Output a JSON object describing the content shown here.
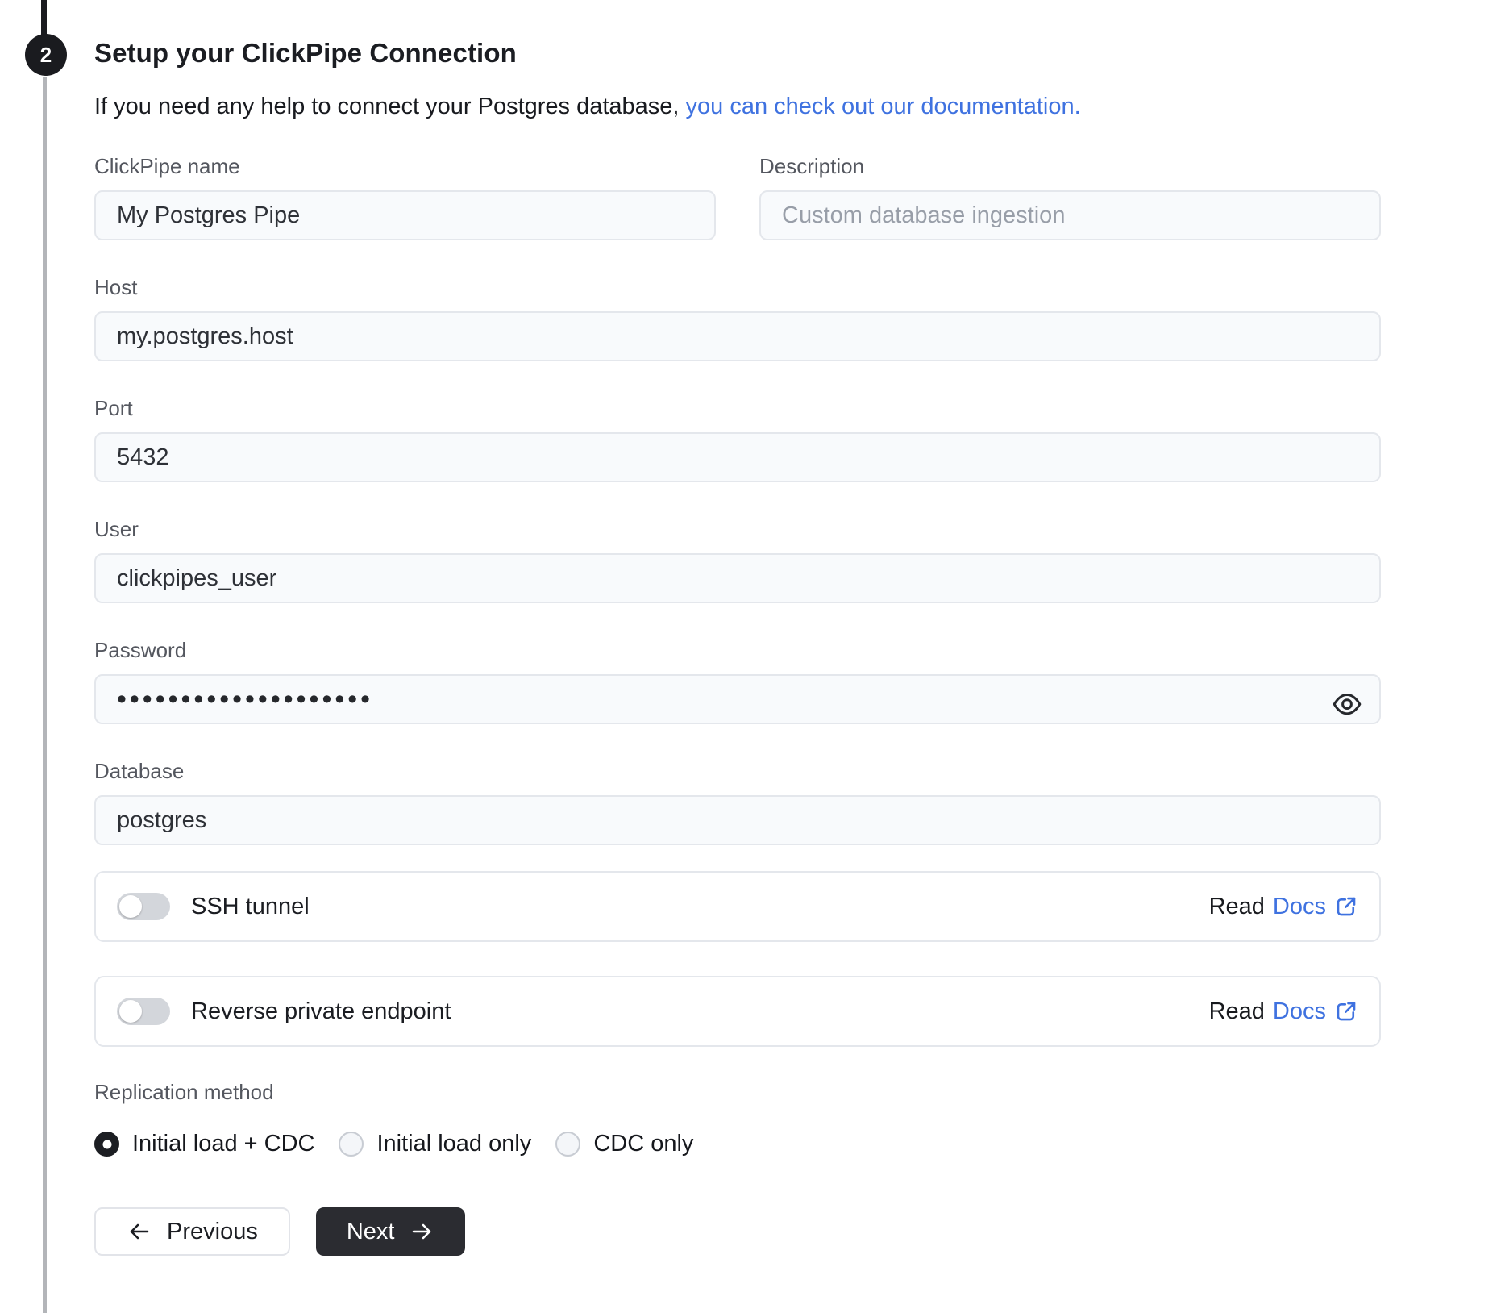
{
  "step": {
    "number": "2"
  },
  "header": {
    "title": "Setup your ClickPipe Connection",
    "subtitle_text": "If you need any help to connect your Postgres database,",
    "subtitle_link": "you can check out our documentation."
  },
  "form": {
    "clickpipe_name": {
      "label": "ClickPipe name",
      "value": "My Postgres Pipe"
    },
    "description": {
      "label": "Description",
      "placeholder": "Custom database ingestion"
    },
    "host": {
      "label": "Host",
      "value": "my.postgres.host"
    },
    "port": {
      "label": "Port",
      "value": "5432"
    },
    "user": {
      "label": "User",
      "value": "clickpipes_user"
    },
    "password": {
      "label": "Password",
      "masked_value": "••••••••••••••••••••"
    },
    "database": {
      "label": "Database",
      "value": "postgres"
    }
  },
  "toggle_rows": {
    "ssh_tunnel": {
      "label": "SSH tunnel",
      "state": "off",
      "read_text": "Read",
      "docs_link": "Docs"
    },
    "reverse_private_endpoint": {
      "label": "Reverse private endpoint",
      "state": "off",
      "read_text": "Read",
      "docs_link": "Docs"
    }
  },
  "replication": {
    "label": "Replication method",
    "options": [
      {
        "label": "Initial load + CDC",
        "selected": true
      },
      {
        "label": "Initial load only",
        "selected": false
      },
      {
        "label": "CDC only",
        "selected": false
      }
    ]
  },
  "actions": {
    "previous": "Previous",
    "next": "Next"
  },
  "colors": {
    "link_blue": "#3f72e0",
    "button_dark": "#2b2c31",
    "rail_gray": "#b3b5b9"
  }
}
